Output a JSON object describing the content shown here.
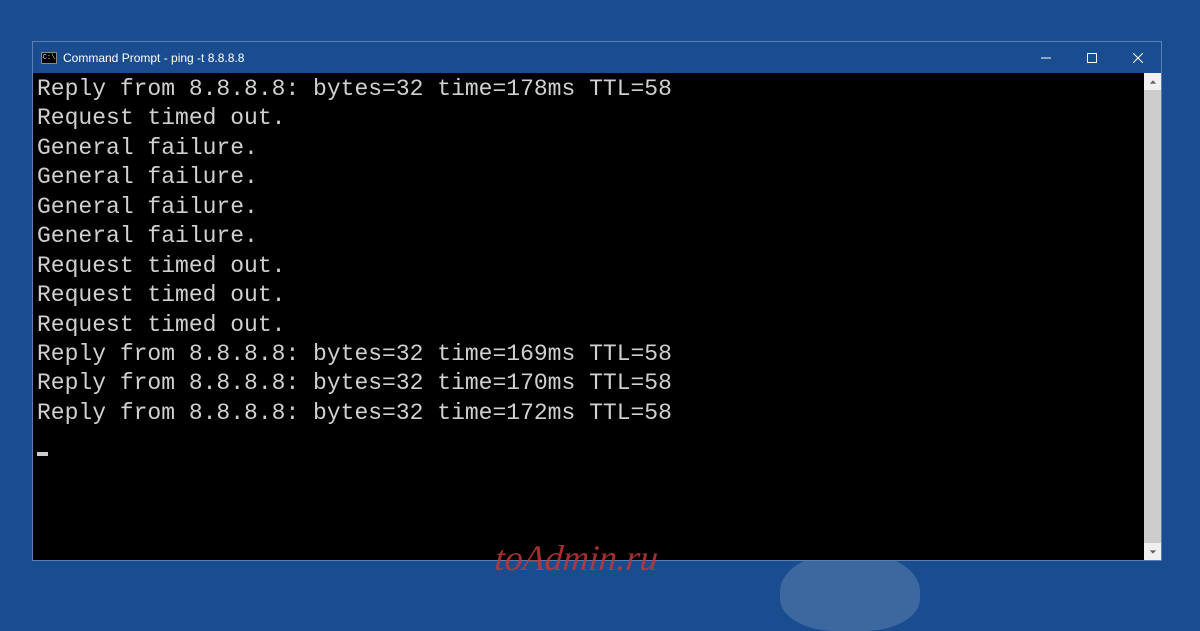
{
  "window": {
    "title": "Command Prompt - ping  -t 8.8.8.8",
    "icon_text": "C:\\"
  },
  "console": {
    "lines": [
      "Reply from 8.8.8.8: bytes=32 time=178ms TTL=58",
      "Request timed out.",
      "General failure.",
      "General failure.",
      "General failure.",
      "General failure.",
      "Request timed out.",
      "Request timed out.",
      "Request timed out.",
      "Reply from 8.8.8.8: bytes=32 time=169ms TTL=58",
      "Reply from 8.8.8.8: bytes=32 time=170ms TTL=58",
      "Reply from 8.8.8.8: bytes=32 time=172ms TTL=58"
    ]
  },
  "watermark": "toAdmin.ru"
}
